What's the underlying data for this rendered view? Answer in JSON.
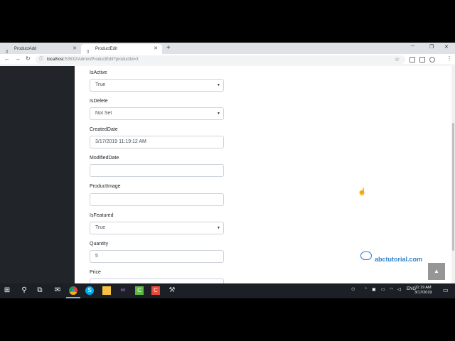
{
  "browser": {
    "tabs": [
      {
        "label": "ProductAdd",
        "active": false
      },
      {
        "label": "ProductEdit",
        "active": true
      }
    ],
    "new_tab": "+",
    "address": {
      "host": "localhost",
      "path": ":53532/Admin/ProductEdit?productId=3"
    }
  },
  "form": {
    "isactive": {
      "label": "IsActive",
      "value": "True"
    },
    "isdelete": {
      "label": "IsDelete",
      "value": "Not Set"
    },
    "createddate": {
      "label": "CreatedDate",
      "value": "3/17/2019 11:19:12 AM"
    },
    "modifieddate": {
      "label": "ModifiedDate",
      "value": ""
    },
    "productimage": {
      "label": "ProductImage",
      "value": ""
    },
    "isfeatured": {
      "label": "IsFeatured",
      "value": "True"
    },
    "quantity": {
      "label": "Quantity",
      "value": "5"
    },
    "price": {
      "label": "Price"
    }
  },
  "watermark": "abctutorial.com",
  "taskbar": {
    "lang": "ENG",
    "time": "11:19 AM",
    "date": "3/17/2019",
    "notifications": "2"
  },
  "colors": {
    "sidebar": "#212529",
    "watermark": "#2f80c8",
    "taskbar": "#1c1f26"
  },
  "icons": [
    "tab-favicon-icon",
    "close-icon",
    "back-icon",
    "forward-icon",
    "reload-icon",
    "info-icon",
    "star-icon",
    "extension-icon",
    "menu-icon",
    "scroll-top-icon",
    "windows-start-icon",
    "search-icon",
    "task-view-icon",
    "mail-icon",
    "chrome-icon",
    "skype-icon",
    "file-explorer-icon",
    "visual-studio-icon",
    "camtasia-icon",
    "recorder-icon",
    "tools-icon",
    "notification-icon"
  ]
}
